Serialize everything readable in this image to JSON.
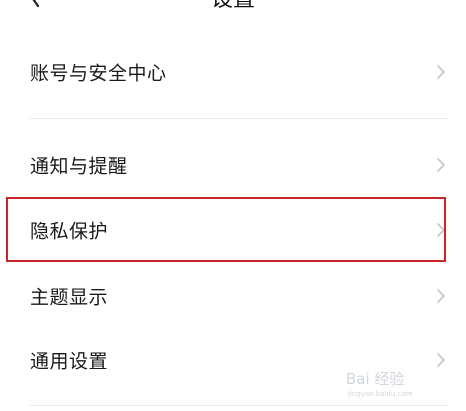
{
  "header": {
    "title": "设置"
  },
  "settings": {
    "items": [
      {
        "label": "账号与安全中心"
      },
      {
        "label": "通知与提醒"
      },
      {
        "label": "隐私保护"
      },
      {
        "label": "主题显示"
      },
      {
        "label": "通用设置"
      }
    ],
    "highlighted_item": "隐私保护"
  },
  "colors": {
    "highlight": "#c9252b",
    "chevron": "#c4c4c4",
    "text": "#1a1a1a"
  },
  "icons": {
    "back": "chevron-left-icon",
    "row_arrow": "chevron-right-icon"
  },
  "watermark": {
    "text": "Bai 经验",
    "sub": "jingyan.baidu.com"
  }
}
